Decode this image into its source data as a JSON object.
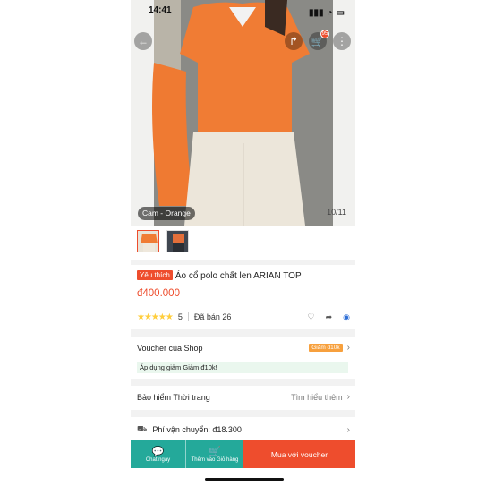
{
  "status_bar": {
    "time": "14:41"
  },
  "header": {
    "back_icon": "arrow-left-icon",
    "share_icon": "share-icon",
    "cart_icon": "cart-icon",
    "cart_badge": "95",
    "more_icon": "more-icon"
  },
  "gallery": {
    "variant_label": "Cam - Orange",
    "counter": "10/11"
  },
  "product": {
    "tag": "Yêu thích",
    "title": "Áo cổ polo chất len ARIAN TOP",
    "price": "đ400.000",
    "rating_value": "5",
    "sold": "Đã bán 26"
  },
  "voucher": {
    "label": "Voucher của Shop",
    "chip": "Giảm đ10k",
    "note": "Áp dụng giảm Giảm đ10k!"
  },
  "insurance": {
    "label": "Bảo hiểm Thời trang",
    "link": "Tìm hiểu thêm"
  },
  "shipping": {
    "label": "Phí vận chuyển: đ18.300"
  },
  "bottom_bar": {
    "chat_label": "Chat ngay",
    "cart_label": "Thêm vào Giỏ hàng",
    "buy_label": "Mua với voucher"
  },
  "colors": {
    "accent": "#ee4d2d",
    "teal": "#24a99a",
    "star": "#ffce3d"
  }
}
